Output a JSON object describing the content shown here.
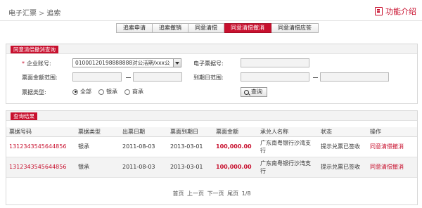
{
  "breadcrumb": {
    "root": "电子汇票",
    "separator": ">",
    "current": "追索"
  },
  "header": {
    "func_intro": "功能介绍"
  },
  "tabs": [
    {
      "label": "追索申请",
      "active": false
    },
    {
      "label": "追索撤销",
      "active": false
    },
    {
      "label": "同意清偿",
      "active": false
    },
    {
      "label": "同意清偿撤消",
      "active": true
    },
    {
      "label": "同意清偿应答",
      "active": false
    }
  ],
  "query_panel": {
    "title": "同意清偿撤消查询",
    "account_label": "企业账号:",
    "account_value": "01000120198888888对公活期/xxx公",
    "bill_no_label": "电子票据号:",
    "bill_no_value": "",
    "amount_label": "票面金额范围:",
    "amount_from": "",
    "amount_to": "",
    "due_label": "到期日范围:",
    "due_from": "",
    "due_to": "",
    "type_label": "票据类型:",
    "type_options": [
      "全部",
      "银承",
      "商承"
    ],
    "type_selected": "全部",
    "query_button": "查询"
  },
  "result_panel": {
    "title": "查询结果",
    "columns": [
      "票据号码",
      "票据类型",
      "出票日期",
      "票面到期日",
      "票面金额",
      "承兑人名称",
      "状态",
      "操作"
    ],
    "rows": [
      {
        "bill_no": "1312343545644856",
        "bill_type": "银承",
        "issue_date": "2011-08-03",
        "due_date": "2013-03-01",
        "amount": "100,000.00",
        "acceptor_line1": "广东南粤银行沙湾支",
        "acceptor_line2": "行",
        "status": "提示兑票已签收",
        "action": "同意清偿撤消"
      },
      {
        "bill_no": "1312343545644856",
        "bill_type": "银承",
        "issue_date": "2011-08-03",
        "due_date": "2013-03-01",
        "amount": "100,000.00",
        "acceptor_line1": "广东南粤银行沙湾支",
        "acceptor_line2": "行",
        "status": "提示兑票已签收",
        "action": "同意清偿撤消"
      }
    ],
    "pager": {
      "first": "首页",
      "prev": "上一页",
      "next": "下一页",
      "last": "尾页",
      "page_info": "1/8"
    }
  },
  "colors": {
    "accent": "#c8102e",
    "border": "#d8d8d8"
  }
}
